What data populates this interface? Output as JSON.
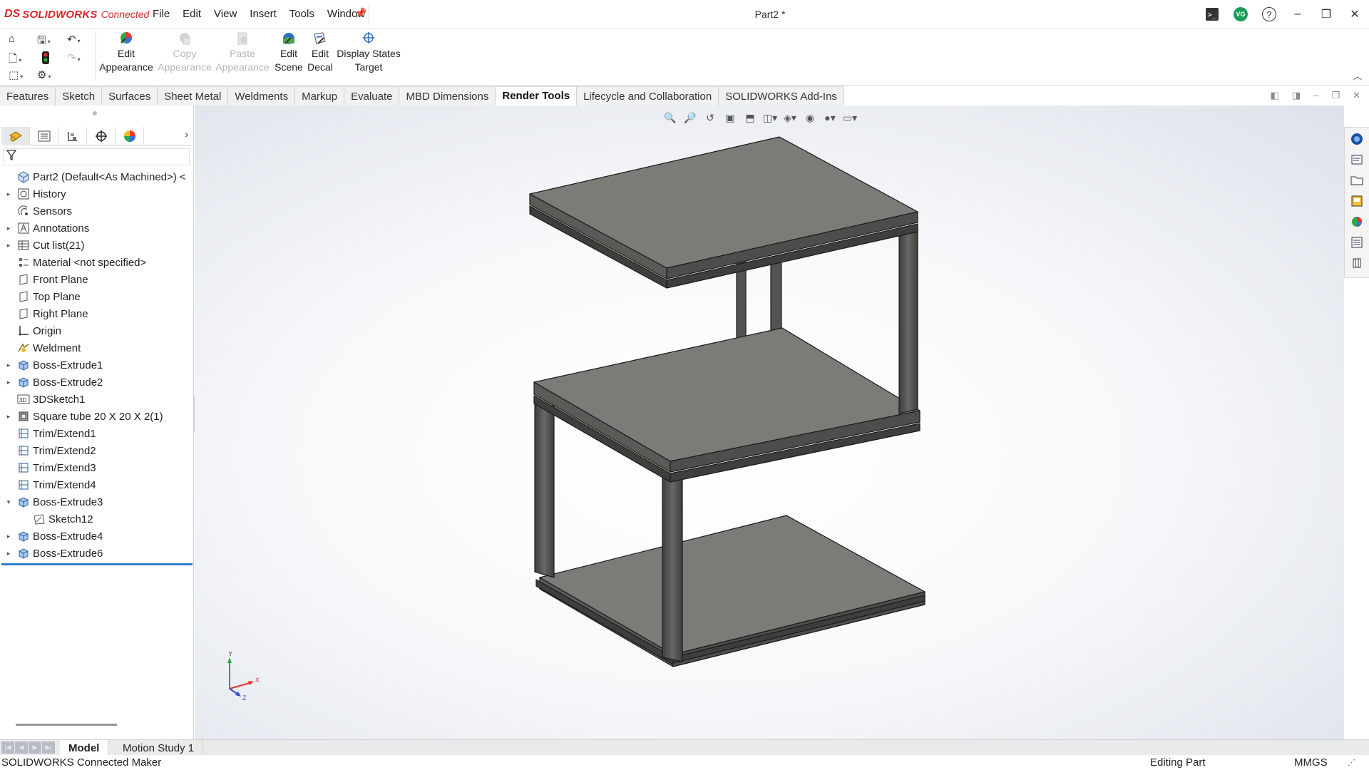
{
  "app": {
    "logo_mark": "DS",
    "logo_name": "SOLIDWORKS",
    "logo_suffix": "Connected",
    "document_title": "Part2 *"
  },
  "menu": [
    "File",
    "Edit",
    "View",
    "Insert",
    "Tools",
    "Window"
  ],
  "window_controls": {
    "avatar_initials": "VG",
    "help_glyph": "?",
    "minimize": "–",
    "restore": "❐",
    "close": "✕"
  },
  "ribbon": {
    "buttons": [
      {
        "label1": "Edit",
        "label2": "Appearance",
        "enabled": true,
        "icon": "edit-appearance-icon"
      },
      {
        "label1": "Copy",
        "label2": "Appearance",
        "enabled": false,
        "icon": "copy-appearance-icon"
      },
      {
        "label1": "Paste",
        "label2": "Appearance",
        "enabled": false,
        "icon": "paste-appearance-icon"
      },
      {
        "label1": "Edit",
        "label2": "Scene",
        "enabled": true,
        "icon": "edit-scene-icon"
      },
      {
        "label1": "Edit",
        "label2": "Decal",
        "enabled": true,
        "icon": "edit-decal-icon"
      },
      {
        "label1": "Display States",
        "label2": "Target",
        "enabled": true,
        "icon": "display-states-target-icon"
      }
    ]
  },
  "tabs": [
    {
      "label": "Features",
      "active": false
    },
    {
      "label": "Sketch",
      "active": false
    },
    {
      "label": "Surfaces",
      "active": false
    },
    {
      "label": "Sheet Metal",
      "active": false
    },
    {
      "label": "Weldments",
      "active": false
    },
    {
      "label": "Markup",
      "active": false
    },
    {
      "label": "Evaluate",
      "active": false
    },
    {
      "label": "MBD Dimensions",
      "active": false
    },
    {
      "label": "Render Tools",
      "active": true
    },
    {
      "label": "Lifecycle and Collaboration",
      "active": false
    },
    {
      "label": "SOLIDWORKS Add-Ins",
      "active": false
    }
  ],
  "feature_tree": [
    {
      "label": "Part2  (Default<As Machined>) <",
      "icon": "part-icon",
      "expander": ""
    },
    {
      "label": "History",
      "icon": "history-icon",
      "expander": "▸"
    },
    {
      "label": "Sensors",
      "icon": "sensors-icon",
      "expander": ""
    },
    {
      "label": "Annotations",
      "icon": "annotations-icon",
      "expander": "▸"
    },
    {
      "label": "Cut list(21)",
      "icon": "cut-list-icon",
      "expander": "▸"
    },
    {
      "label": "Material <not specified>",
      "icon": "material-icon",
      "expander": ""
    },
    {
      "label": "Front Plane",
      "icon": "plane-icon",
      "expander": ""
    },
    {
      "label": "Top Plane",
      "icon": "plane-icon",
      "expander": ""
    },
    {
      "label": "Right Plane",
      "icon": "plane-icon",
      "expander": ""
    },
    {
      "label": "Origin",
      "icon": "origin-icon",
      "expander": ""
    },
    {
      "label": "Weldment",
      "icon": "weldment-icon",
      "expander": ""
    },
    {
      "label": "Boss-Extrude1",
      "icon": "extrude-icon",
      "expander": "▸"
    },
    {
      "label": "Boss-Extrude2",
      "icon": "extrude-icon",
      "expander": "▸"
    },
    {
      "label": "3DSketch1",
      "icon": "3dsketch-icon",
      "expander": ""
    },
    {
      "label": "Square tube 20 X 20 X 2(1)",
      "icon": "structural-member-icon",
      "expander": "▸"
    },
    {
      "label": "Trim/Extend1",
      "icon": "trim-extend-icon",
      "expander": ""
    },
    {
      "label": "Trim/Extend2",
      "icon": "trim-extend-icon",
      "expander": ""
    },
    {
      "label": "Trim/Extend3",
      "icon": "trim-extend-icon",
      "expander": ""
    },
    {
      "label": "Trim/Extend4",
      "icon": "trim-extend-icon",
      "expander": ""
    },
    {
      "label": "Boss-Extrude3",
      "icon": "extrude-icon",
      "expander": "▾"
    },
    {
      "label": "Sketch12",
      "icon": "sketch-icon",
      "expander": "",
      "child": true
    },
    {
      "label": "Boss-Extrude4",
      "icon": "extrude-icon",
      "expander": "▸"
    },
    {
      "label": "Boss-Extrude6",
      "icon": "extrude-icon",
      "expander": "▸"
    }
  ],
  "triad": {
    "x": "X",
    "y": "Y",
    "z": "Z"
  },
  "bottom_tabs": {
    "model": "Model",
    "motion": "Motion Study 1"
  },
  "status": {
    "left": "SOLIDWORKS Connected Maker",
    "mode": "Editing Part",
    "units": "MMGS"
  },
  "colors": {
    "accent": "#2f7fd0",
    "logo_red": "#d8262f",
    "panel_gray": "#7d7b78",
    "frame_dark": "#4e4d4b"
  }
}
